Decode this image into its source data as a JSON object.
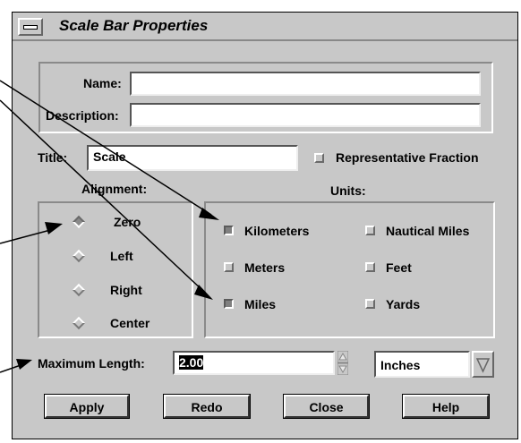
{
  "window": {
    "title": "Scale Bar Properties"
  },
  "fields": {
    "name_label": "Name:",
    "name_value": "",
    "description_label": "Description:",
    "description_value": "",
    "title_label": "Title:",
    "title_value": "Scale",
    "representative_fraction_label": "Representative Fraction",
    "representative_fraction_checked": false
  },
  "alignment": {
    "label": "Alignment:",
    "selected": "Zero",
    "options": [
      "Zero",
      "Left",
      "Right",
      "Center"
    ]
  },
  "units": {
    "label": "Units:",
    "options": [
      {
        "label": "Kilometers",
        "checked": true
      },
      {
        "label": "Nautical Miles",
        "checked": false
      },
      {
        "label": "Meters",
        "checked": false
      },
      {
        "label": "Feet",
        "checked": false
      },
      {
        "label": "Miles",
        "checked": true
      },
      {
        "label": "Yards",
        "checked": false
      }
    ]
  },
  "max_length": {
    "label": "Maximum Length:",
    "value": "2.00",
    "unit": "Inches"
  },
  "buttons": {
    "apply": "Apply",
    "redo": "Redo",
    "close": "Close",
    "help": "Help"
  }
}
